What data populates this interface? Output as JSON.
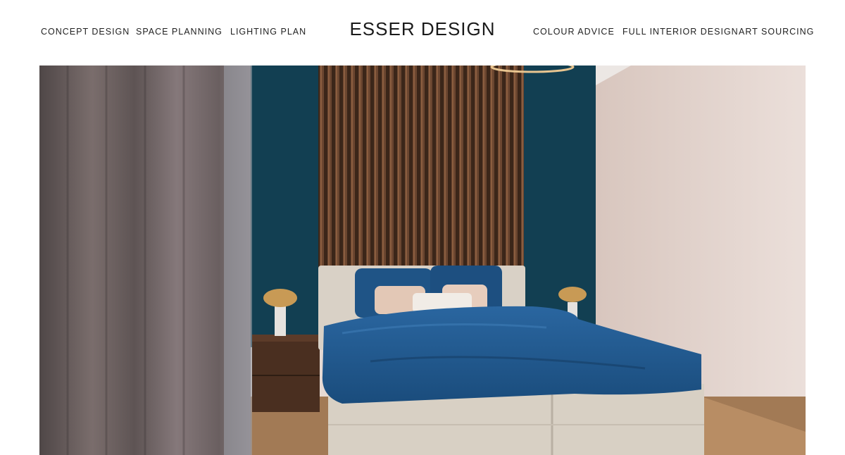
{
  "brand": {
    "name": "ESSER DESIGN"
  },
  "nav": {
    "left": [
      {
        "label": "CONCEPT DESIGN"
      },
      {
        "label": "SPACE PLANNING"
      },
      {
        "label": "LIGHTING PLAN"
      }
    ],
    "right": [
      {
        "label": "COLOUR ADVICE"
      },
      {
        "label": "FULL INTERIOR DESIGN"
      },
      {
        "label": "ART SOURCING"
      }
    ]
  },
  "colors": {
    "wall_blue": "#123f52",
    "bedding_blue": "#1e5789",
    "slat_wood": "#5a3a26",
    "wall_pink": "#e3d3cc",
    "curtain": "#6f6363",
    "headboard": "#d9d1c6",
    "brass": "#c89a55"
  }
}
